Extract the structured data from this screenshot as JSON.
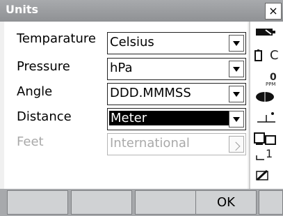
{
  "window": {
    "title": "Units",
    "close_glyph": "×"
  },
  "form": {
    "rows": [
      {
        "label": "Temparature",
        "value": "Celsius"
      },
      {
        "label": "Pressure",
        "value": "hPa"
      },
      {
        "label": "Angle",
        "value": "DDD.MMMSS"
      },
      {
        "label": "Distance",
        "value": "Meter"
      },
      {
        "label": "Feet",
        "value": "International"
      }
    ]
  },
  "sidebar": {
    "battery_text": "C",
    "ppm_value": "0",
    "ppm_unit": "PPM",
    "mode_digit": "1"
  },
  "fkeys": [
    "",
    "",
    "",
    "OK",
    ""
  ]
}
